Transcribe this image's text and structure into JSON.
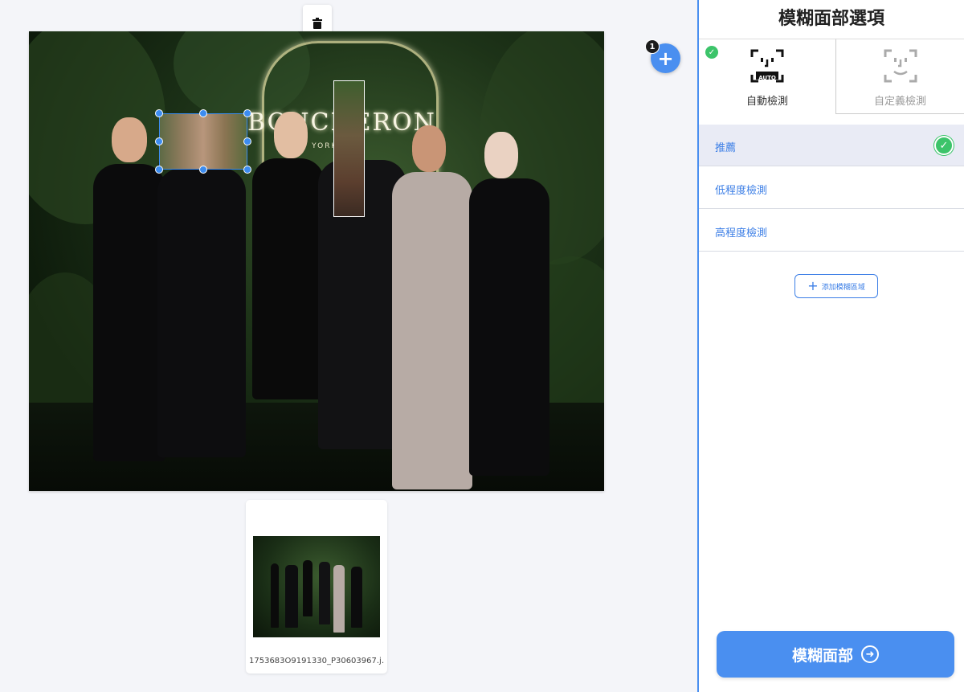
{
  "panel": {
    "title": "模糊面部選項",
    "tabs": [
      {
        "label": "自動檢測",
        "icon": "auto-face-detect-icon",
        "icon_text": "AUTO",
        "selected": true
      },
      {
        "label": "自定義檢測",
        "icon": "custom-face-detect-icon",
        "selected": false
      }
    ],
    "options": [
      {
        "label": "推薦",
        "selected": true
      },
      {
        "label": "低程度檢測",
        "selected": false
      },
      {
        "label": "高程度檢測",
        "selected": false
      }
    ],
    "add_region_label": "添加模糊區域",
    "blur_button_label": "模糊面部"
  },
  "canvas": {
    "add_badge_count": "1",
    "photo_sign_text": "BOUCHERON",
    "photo_sign_sub": "NEW YORK",
    "thumbnail": {
      "filename": "1753683O9191330_P30603967.j…"
    }
  },
  "colors": {
    "accent": "#4a8ff0",
    "link_blue": "#3b7ee6",
    "success_green": "#3cc46a",
    "selected_row_bg": "#e9ebf5"
  }
}
